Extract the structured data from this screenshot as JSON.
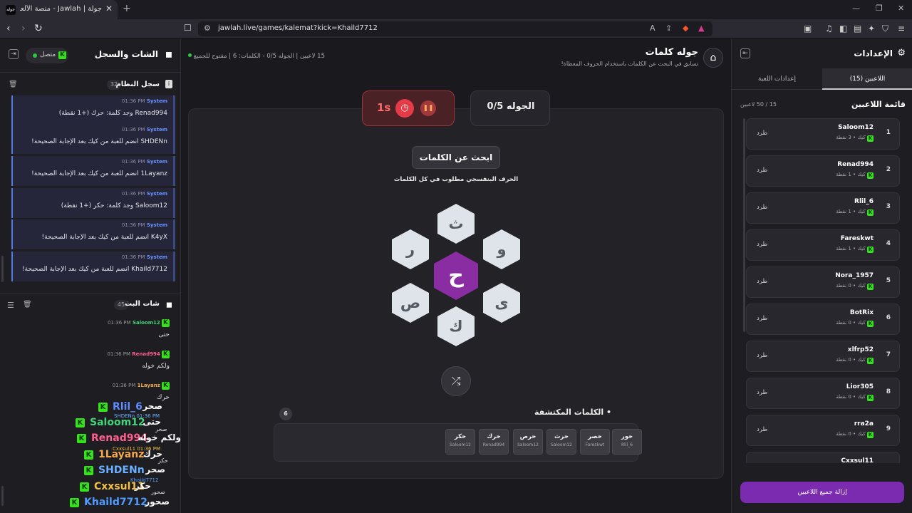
{
  "browser": {
    "tab_title": "جولة | Jawlah - منصة الألعاب التفا",
    "tab_favicon_text": "جوله",
    "url": "jawlah.live/games/kalemat?kick=Khaild7712"
  },
  "left_panel": {
    "title": "الشات والسجل",
    "status": "متصل",
    "system_log": {
      "title": "سجل النظام",
      "count": "32",
      "entries": [
        {
          "author": "System",
          "time": "01:36 PM",
          "text": "Renad994 وجد كلمة: حرك (+1 نقطة)"
        },
        {
          "author": "System",
          "time": "01:36 PM",
          "text": "SHDENn انضم للعبة من كيك بعد الإجابة الصحيحة!"
        },
        {
          "author": "System",
          "time": "01:36 PM",
          "text": "1Layanz انضم للعبة من كيك بعد الإجابة الصحيحة!"
        },
        {
          "author": "System",
          "time": "01:36 PM",
          "text": "Saloom12 وجد كلمة: حكر (+1 نقطة)"
        },
        {
          "author": "System",
          "time": "01:36 PM",
          "text": "K4yX انضم للعبة من كيك بعد الإجابة الصحيحة!"
        },
        {
          "author": "System",
          "time": "01:36 PM",
          "text": "Khaild7712 انضم للعبة من كيك بعد الإجابة الصحيحة!"
        }
      ]
    },
    "stream_chat": {
      "title": "شات البث",
      "count": "45",
      "messages": [
        {
          "author": "Saloom12",
          "time": "01:36 PM",
          "text": "حتى",
          "color": "#43d37a"
        },
        {
          "author": "Renad994",
          "time": "01:36 PM",
          "text": "ولكم خوله",
          "color": "#ff5f8f"
        },
        {
          "author": "1Layanz",
          "time": "01:36 PM",
          "text": "حرك",
          "color": "#f4a94e"
        }
      ],
      "overlay": [
        {
          "name": "Rlil_6",
          "word": "صحر",
          "color": "#5e8cff"
        },
        {
          "name": "Saloom12",
          "word": "حتى",
          "color": "#43d37a"
        },
        {
          "name": "Renad994",
          "word": "ولكم خوله",
          "color": "#ff5f8f"
        },
        {
          "name": "1Layanz",
          "word": "حرك",
          "color": "#f4a94e"
        },
        {
          "name": "SHDENn",
          "word": "صحر",
          "color": "#6ab0ff"
        },
        {
          "name": "Cxxsul11",
          "word": "حكر",
          "color": "#f3c042"
        },
        {
          "name": "Khaild7712",
          "word": "صحور",
          "color": "#4f9bff"
        }
      ],
      "ghost_lines": [
        {
          "text": "SHDENn 01:36 PM",
          "color": "#6ab0ff"
        },
        {
          "text": "صحر",
          "color": "#ddd"
        },
        {
          "text": "Cxxsul11 01:36 PM",
          "color": "#f3c042"
        },
        {
          "text": "حكر",
          "color": "#ddd"
        },
        {
          "text": "Khaild7712",
          "color": "#4f9bff"
        },
        {
          "text": "صحور",
          "color": "#ddd"
        }
      ]
    }
  },
  "main": {
    "title": "جوله كلمات",
    "subtitle": "تسابق في البحث عن الكلمات باستخدام الحروف المعطاة!",
    "stats": "15 لاعبين | الجوله 0/5 - الكلمات: 6 | مفتوح للجميع",
    "round_label": "الجوله 0/5",
    "timer": "1s",
    "find_button": "ابحث عن الكلمات",
    "hint": "الحرف البنفسجي مطلوب في كل الكلمات",
    "center_letter": "ح",
    "letters": {
      "top": "ث",
      "top_right": "و",
      "bottom_right": "ى",
      "bottom": "ك",
      "bottom_left": "ص",
      "top_left": "ر"
    },
    "found_title": "الكلمات المكتشفة",
    "found_count": "6",
    "found_words": [
      {
        "word": "حور",
        "player": "Rlil_6"
      },
      {
        "word": "حصر",
        "player": "Fareskwt"
      },
      {
        "word": "حرث",
        "player": "Saloom12"
      },
      {
        "word": "حرص",
        "player": "Saloom12"
      },
      {
        "word": "حرك",
        "player": "Renad994"
      },
      {
        "word": "حكر",
        "player": "Saloom12"
      }
    ]
  },
  "right_panel": {
    "title": "الإعدادات",
    "tab_players": "اللاعبين (15)",
    "tab_settings": "إعدادات اللعبة",
    "list_title": "قائمة اللاعبين",
    "list_count": "15 / 50 لاعبين",
    "kick_label": "طرد",
    "source_label": "كيك",
    "players": [
      {
        "rank": "1",
        "name": "Saloom12",
        "points": "3 نقطة"
      },
      {
        "rank": "2",
        "name": "Renad994",
        "points": "1 نقطة"
      },
      {
        "rank": "3",
        "name": "Rlil_6",
        "points": "1 نقطة"
      },
      {
        "rank": "4",
        "name": "Fareskwt",
        "points": "1 نقطة"
      },
      {
        "rank": "5",
        "name": "Nora_1957",
        "points": "0 نقطة"
      },
      {
        "rank": "6",
        "name": "BotRix",
        "points": "0 نقطة"
      },
      {
        "rank": "7",
        "name": "xlfrp52",
        "points": "0 نقطة"
      },
      {
        "rank": "8",
        "name": "Lior305",
        "points": "0 نقطة"
      },
      {
        "rank": "9",
        "name": "rra2a",
        "points": "0 نقطة"
      },
      {
        "rank": "",
        "name": "Cxxsul11",
        "points": ""
      }
    ],
    "remove_all": "إزالة جميع اللاعبين"
  }
}
